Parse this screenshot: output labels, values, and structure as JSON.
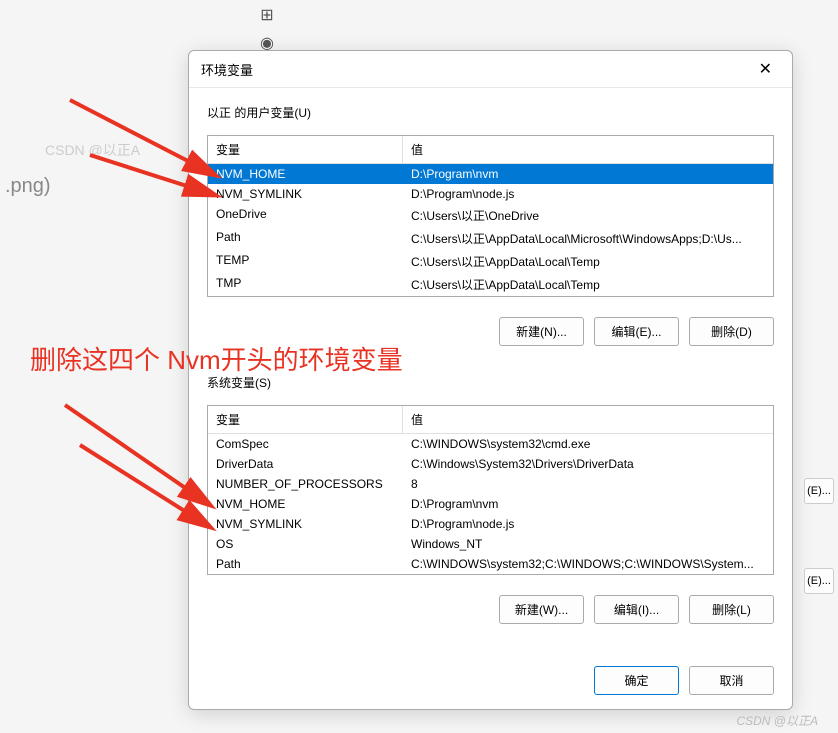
{
  "watermark": "CSDN @以正A",
  "bottom_watermark": "CSDN @以正A",
  "bg_filename": ".png)",
  "dialog": {
    "title": "环境变量",
    "close": "✕",
    "user_section_label": "以正 的用户变量(U)",
    "system_section_label": "系统变量(S)",
    "col_var": "变量",
    "col_val": "值",
    "user_vars": [
      {
        "name": "NVM_HOME",
        "value": "D:\\Program\\nvm",
        "selected": true
      },
      {
        "name": "NVM_SYMLINK",
        "value": "D:\\Program\\node.js",
        "selected": false
      },
      {
        "name": "OneDrive",
        "value": "C:\\Users\\以正\\OneDrive",
        "selected": false
      },
      {
        "name": "Path",
        "value": "C:\\Users\\以正\\AppData\\Local\\Microsoft\\WindowsApps;D:\\Us...",
        "selected": false
      },
      {
        "name": "TEMP",
        "value": "C:\\Users\\以正\\AppData\\Local\\Temp",
        "selected": false
      },
      {
        "name": "TMP",
        "value": "C:\\Users\\以正\\AppData\\Local\\Temp",
        "selected": false
      }
    ],
    "system_vars": [
      {
        "name": "ComSpec",
        "value": "C:\\WINDOWS\\system32\\cmd.exe"
      },
      {
        "name": "DriverData",
        "value": "C:\\Windows\\System32\\Drivers\\DriverData"
      },
      {
        "name": "NUMBER_OF_PROCESSORS",
        "value": "8"
      },
      {
        "name": "NVM_HOME",
        "value": "D:\\Program\\nvm"
      },
      {
        "name": "NVM_SYMLINK",
        "value": "D:\\Program\\node.js"
      },
      {
        "name": "OS",
        "value": "Windows_NT"
      },
      {
        "name": "Path",
        "value": "C:\\WINDOWS\\system32;C:\\WINDOWS;C:\\WINDOWS\\System..."
      }
    ],
    "buttons": {
      "new_u": "新建(N)...",
      "edit_u": "编辑(E)...",
      "delete_u": "删除(D)",
      "new_s": "新建(W)...",
      "edit_s": "编辑(I)...",
      "delete_s": "删除(L)",
      "ok": "确定",
      "cancel": "取消"
    }
  },
  "annotation": "删除这四个 Nvm开头的环境变量",
  "side_edit": "(E)..."
}
